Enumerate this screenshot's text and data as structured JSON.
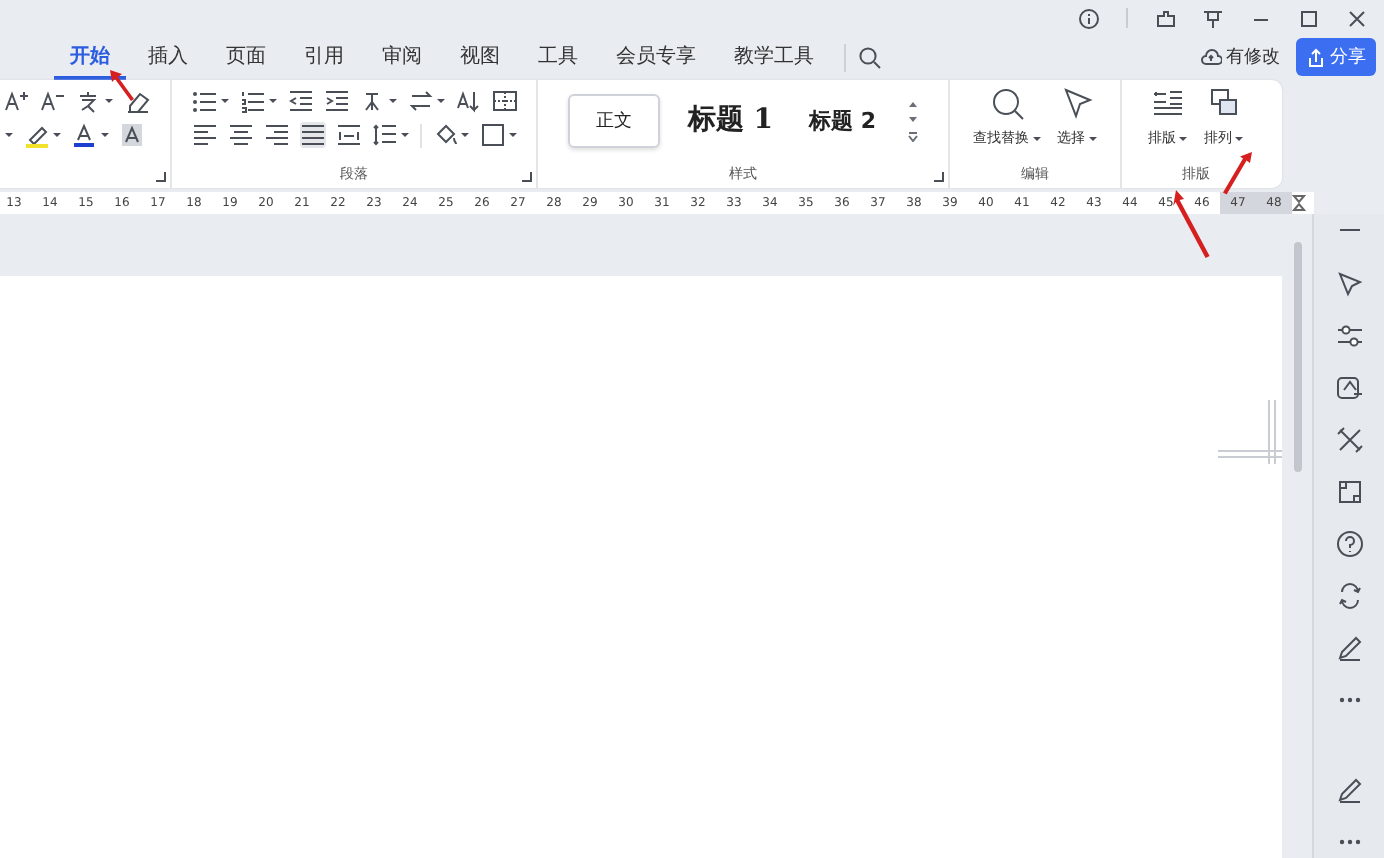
{
  "tabs": [
    {
      "label": "开始",
      "selected": true
    },
    {
      "label": "插入",
      "selected": false
    },
    {
      "label": "页面",
      "selected": false
    },
    {
      "label": "引用",
      "selected": false
    },
    {
      "label": "审阅",
      "selected": false
    },
    {
      "label": "视图",
      "selected": false
    },
    {
      "label": "工具",
      "selected": false
    },
    {
      "label": "会员专享",
      "selected": false
    },
    {
      "label": "教学工具",
      "selected": false
    }
  ],
  "save_status": "有修改",
  "share_button": "分享",
  "ribbon": {
    "paragraph_label": "段落",
    "styles": {
      "label": "样式",
      "items": [
        {
          "label": "正文",
          "kind": "body",
          "selected": true
        },
        {
          "label": "标题 1",
          "kind": "heading1",
          "selected": false
        },
        {
          "label": "标题 2",
          "kind": "heading2",
          "selected": false
        }
      ]
    },
    "editing": {
      "label": "编辑",
      "buttons": [
        {
          "label": "查找替换",
          "kind": "find"
        },
        {
          "label": "选择",
          "kind": "select"
        }
      ]
    },
    "layout": {
      "label": "排版",
      "buttons": [
        {
          "label": "排版",
          "kind": "typeset"
        },
        {
          "label": "排列",
          "kind": "arrange"
        }
      ]
    }
  },
  "ruler": [
    {
      "label": "13",
      "in_margin": false
    },
    {
      "label": "14",
      "in_margin": false
    },
    {
      "label": "15",
      "in_margin": false
    },
    {
      "label": "16",
      "in_margin": false
    },
    {
      "label": "17",
      "in_margin": false
    },
    {
      "label": "18",
      "in_margin": false
    },
    {
      "label": "19",
      "in_margin": false
    },
    {
      "label": "20",
      "in_margin": false
    },
    {
      "label": "21",
      "in_margin": false
    },
    {
      "label": "22",
      "in_margin": false
    },
    {
      "label": "23",
      "in_margin": false
    },
    {
      "label": "24",
      "in_margin": false
    },
    {
      "label": "25",
      "in_margin": false
    },
    {
      "label": "26",
      "in_margin": false
    },
    {
      "label": "27",
      "in_margin": false
    },
    {
      "label": "28",
      "in_margin": false
    },
    {
      "label": "29",
      "in_margin": false
    },
    {
      "label": "30",
      "in_margin": false
    },
    {
      "label": "31",
      "in_margin": false
    },
    {
      "label": "32",
      "in_margin": false
    },
    {
      "label": "33",
      "in_margin": false
    },
    {
      "label": "34",
      "in_margin": false
    },
    {
      "label": "35",
      "in_margin": false
    },
    {
      "label": "36",
      "in_margin": false
    },
    {
      "label": "37",
      "in_margin": false
    },
    {
      "label": "38",
      "in_margin": false
    },
    {
      "label": "39",
      "in_margin": false
    },
    {
      "label": "40",
      "in_margin": false
    },
    {
      "label": "41",
      "in_margin": false
    },
    {
      "label": "42",
      "in_margin": false
    },
    {
      "label": "43",
      "in_margin": false
    },
    {
      "label": "44",
      "in_margin": false
    },
    {
      "label": "45",
      "in_margin": false
    },
    {
      "label": "46",
      "in_margin": false
    },
    {
      "label": "47",
      "in_margin": true
    },
    {
      "label": "48",
      "in_margin": true
    }
  ]
}
